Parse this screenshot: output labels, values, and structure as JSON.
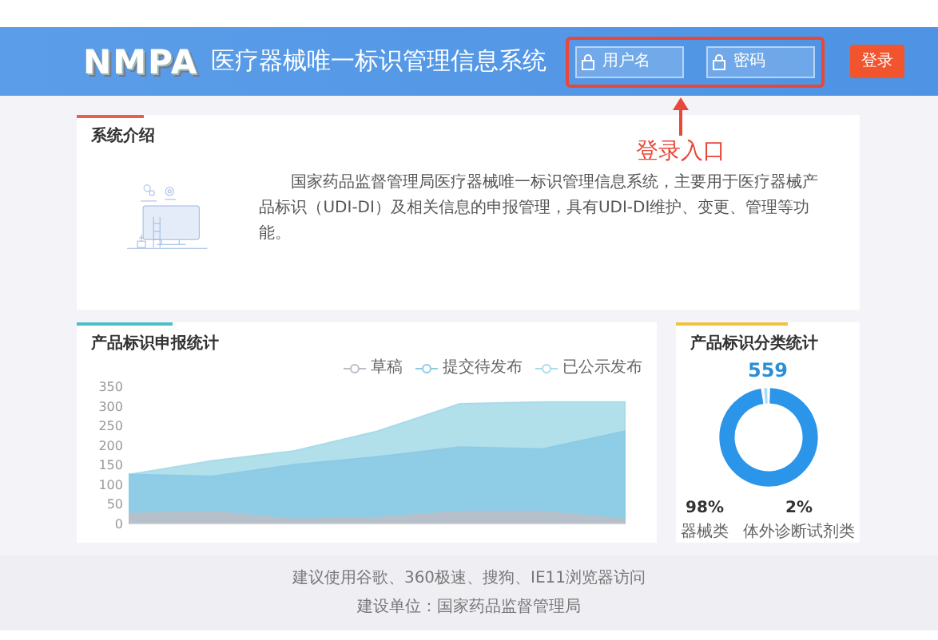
{
  "header": {
    "logo": "NMPA",
    "title": "医疗器械唯一标识管理信息系统",
    "login": {
      "username_placeholder": "用户名",
      "password_placeholder": "密码",
      "button": "登录"
    }
  },
  "annotation": {
    "text": "登录入口"
  },
  "intro": {
    "title": "系统介绍",
    "text": "国家药品监督管理局医疗器械唯一标识管理信息系统，主要用于医疗器械产品标识（UDI-DI）及相关信息的申报管理，具有UDI-DI维护、变更、管理等功能。"
  },
  "report_stats": {
    "title": "产品标识申报统计",
    "chart_data": {
      "type": "area",
      "yticks": [
        0,
        50,
        100,
        150,
        200,
        250,
        300,
        350
      ],
      "ylim": [
        0,
        350
      ],
      "series": [
        {
          "name": "草稿",
          "color": "#b9bfc7",
          "values": [
            25,
            30,
            10,
            15,
            30,
            30,
            10
          ]
        },
        {
          "name": "提交待发布",
          "color": "#8ccbe6",
          "values": [
            125,
            120,
            150,
            170,
            195,
            190,
            235
          ]
        },
        {
          "name": "已公示发布",
          "color": "#a9dbe8",
          "values": [
            125,
            160,
            185,
            235,
            305,
            310,
            310
          ]
        }
      ]
    }
  },
  "category_stats": {
    "title": "产品标识分类统计",
    "total": "559",
    "items": [
      {
        "percent": "98%",
        "label": "器械类",
        "color": "#2b95ea"
      },
      {
        "percent": "2%",
        "label": "体外诊断试剂类",
        "color": "#a7dcf5"
      }
    ]
  },
  "footer": {
    "lines": [
      "建议使用谷歌、360极速、搜狗、IE11浏览器访问",
      "建设单位：国家药品监督管理局"
    ]
  }
}
